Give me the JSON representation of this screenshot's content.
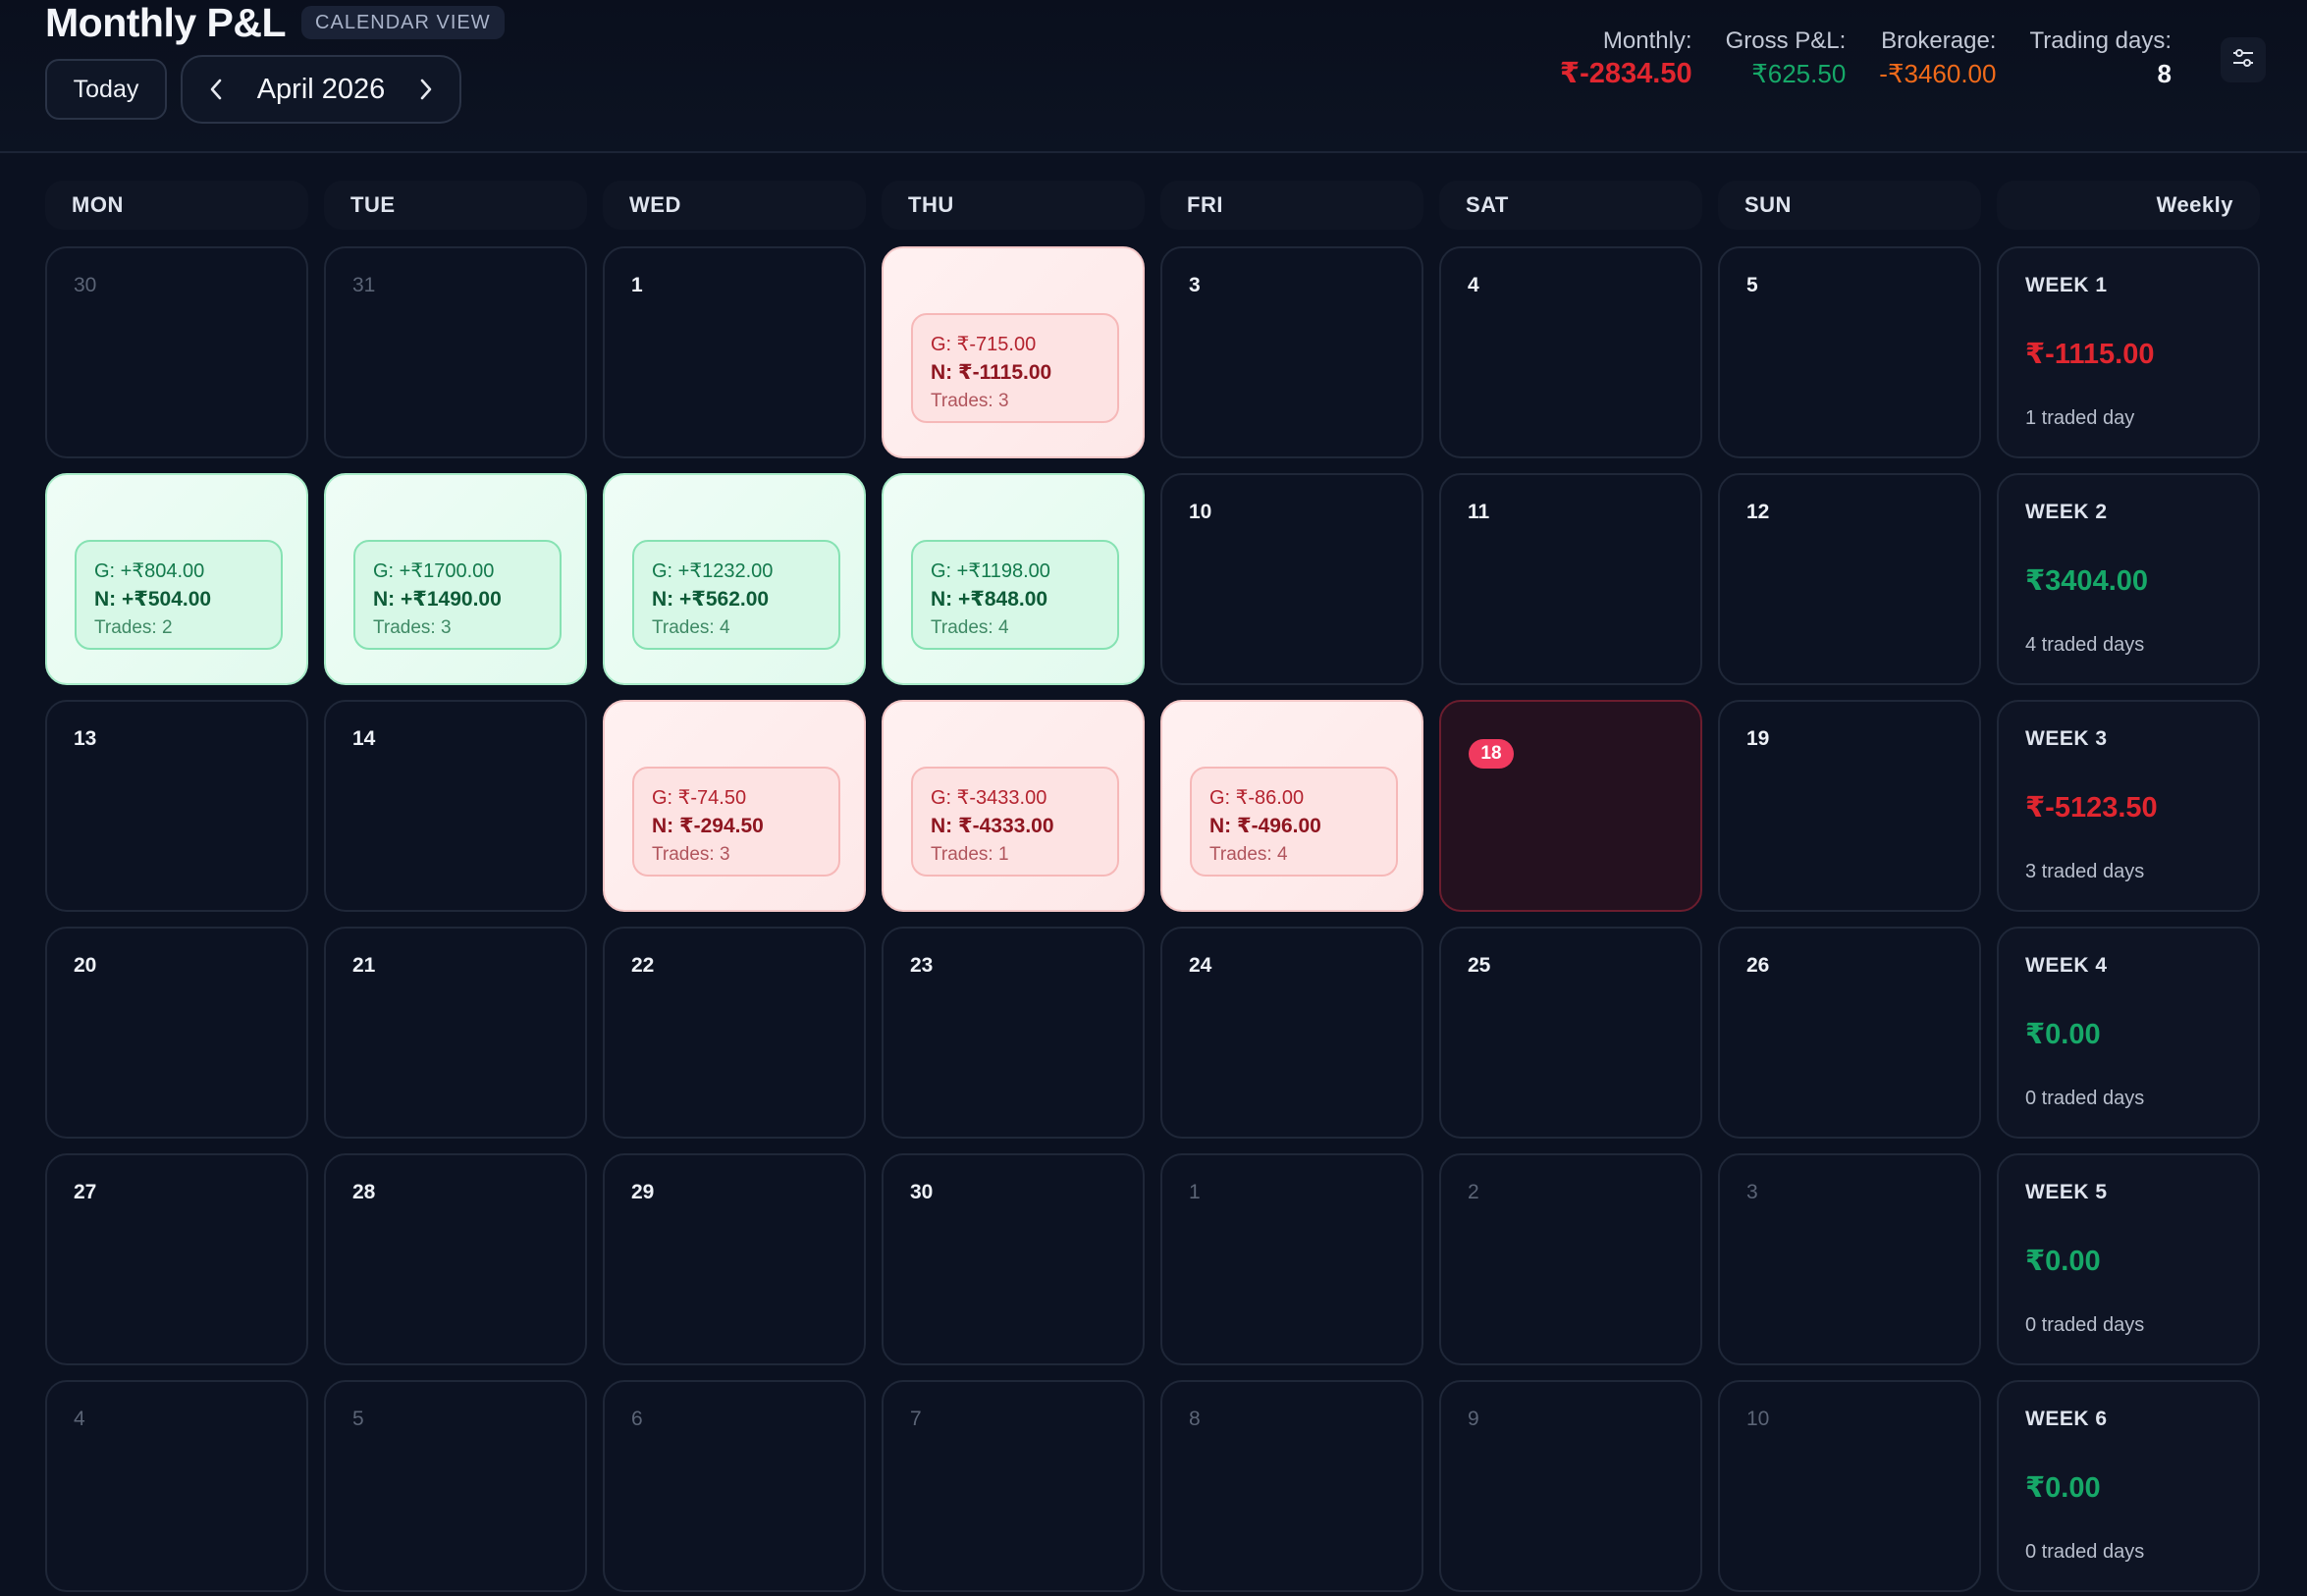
{
  "header": {
    "title": "Monthly P&L",
    "badge": "CALENDAR VIEW",
    "today_label": "Today",
    "month_label": "April 2026"
  },
  "stats": {
    "monthly_label": "Monthly:",
    "monthly_value": "₹-2834.50",
    "gross_label": "Gross P&L:",
    "gross_value": "₹625.50",
    "brokerage_label": "Brokerage:",
    "brokerage_value": "-₹3460.00",
    "days_label": "Trading days:",
    "days_value": "8"
  },
  "colors": {
    "negative": "#e0262f",
    "positive": "#16a868",
    "brokerage": "#f06a1a",
    "today": "#f03a5f"
  },
  "days_of_week": [
    "MON",
    "TUE",
    "WED",
    "THU",
    "FRI",
    "SAT",
    "SUN"
  ],
  "weekly_header": "Weekly",
  "weeks": [
    {
      "label": "WEEK 1",
      "value": "₹-1115.00",
      "sign": "neg",
      "days": "1 traded day",
      "cells": [
        {
          "day": "30",
          "muted": true
        },
        {
          "day": "31",
          "muted": true
        },
        {
          "day": "1"
        },
        {
          "day": "",
          "status": "red",
          "g": "G: ₹-715.00",
          "n": "N: ₹-1115.00",
          "t": "Trades: 3"
        },
        {
          "day": "3"
        },
        {
          "day": "4"
        },
        {
          "day": "5"
        }
      ]
    },
    {
      "label": "WEEK 2",
      "value": "₹3404.00",
      "sign": "pos",
      "days": "4 traded days",
      "cells": [
        {
          "day": "",
          "status": "green",
          "g": "G: +₹804.00",
          "n": "N: +₹504.00",
          "t": "Trades: 2"
        },
        {
          "day": "",
          "status": "green",
          "g": "G: +₹1700.00",
          "n": "N: +₹1490.00",
          "t": "Trades: 3"
        },
        {
          "day": "",
          "status": "green",
          "g": "G: +₹1232.00",
          "n": "N: +₹562.00",
          "t": "Trades: 4"
        },
        {
          "day": "",
          "status": "green",
          "g": "G: +₹1198.00",
          "n": "N: +₹848.00",
          "t": "Trades: 4"
        },
        {
          "day": "10"
        },
        {
          "day": "11"
        },
        {
          "day": "12"
        }
      ]
    },
    {
      "label": "WEEK 3",
      "value": "₹-5123.50",
      "sign": "neg",
      "days": "3 traded days",
      "cells": [
        {
          "day": "13"
        },
        {
          "day": "14"
        },
        {
          "day": "",
          "status": "red",
          "g": "G: ₹-74.50",
          "n": "N: ₹-294.50",
          "t": "Trades: 3"
        },
        {
          "day": "",
          "status": "red",
          "g": "G: ₹-3433.00",
          "n": "N: ₹-4333.00",
          "t": "Trades: 1"
        },
        {
          "day": "",
          "status": "red",
          "g": "G: ₹-86.00",
          "n": "N: ₹-496.00",
          "t": "Trades: 4"
        },
        {
          "day": "18",
          "today": true
        },
        {
          "day": "19"
        }
      ]
    },
    {
      "label": "WEEK 4",
      "value": "₹0.00",
      "sign": "pos",
      "days": "0 traded days",
      "cells": [
        {
          "day": "20"
        },
        {
          "day": "21"
        },
        {
          "day": "22"
        },
        {
          "day": "23"
        },
        {
          "day": "24"
        },
        {
          "day": "25"
        },
        {
          "day": "26"
        }
      ]
    },
    {
      "label": "WEEK 5",
      "value": "₹0.00",
      "sign": "pos",
      "days": "0 traded days",
      "cells": [
        {
          "day": "27"
        },
        {
          "day": "28"
        },
        {
          "day": "29"
        },
        {
          "day": "30"
        },
        {
          "day": "1",
          "muted": true
        },
        {
          "day": "2",
          "muted": true
        },
        {
          "day": "3",
          "muted": true
        }
      ]
    },
    {
      "label": "WEEK 6",
      "value": "₹0.00",
      "sign": "pos",
      "days": "0 traded days",
      "cells": [
        {
          "day": "4",
          "muted": true
        },
        {
          "day": "5",
          "muted": true
        },
        {
          "day": "6",
          "muted": true
        },
        {
          "day": "7",
          "muted": true
        },
        {
          "day": "8",
          "muted": true
        },
        {
          "day": "9",
          "muted": true
        },
        {
          "day": "10",
          "muted": true
        }
      ]
    }
  ]
}
